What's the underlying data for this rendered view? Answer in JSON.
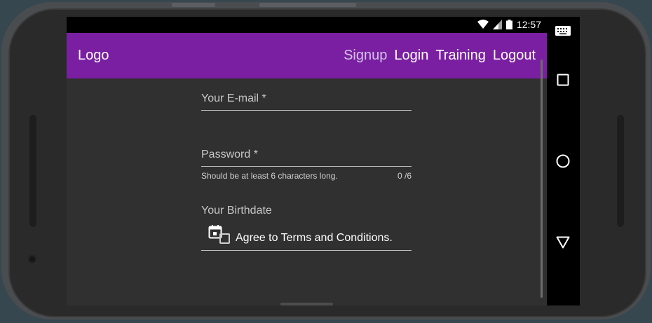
{
  "status_bar": {
    "time": "12:57",
    "icons": [
      "wifi-icon",
      "signal-icon",
      "battery-icon"
    ]
  },
  "app_bar": {
    "logo": "Logo",
    "nav": [
      "Signup",
      "Login",
      "Training",
      "Logout"
    ],
    "active_nav": "Signup",
    "color": "#7b1fa2"
  },
  "form": {
    "email": {
      "label": "Your E-mail *",
      "value": ""
    },
    "password": {
      "label": "Password *",
      "hint": "Should be at least 6 characters long.",
      "counter": "0 /6",
      "value": ""
    },
    "birthdate": {
      "label": "Your Birthdate",
      "icon": "calendar-icon",
      "value": ""
    },
    "terms": {
      "label": "Agree to Terms and Conditions.",
      "checked": false
    }
  },
  "system_nav": {
    "buttons": [
      "keyboard-icon",
      "recents-icon",
      "home-icon",
      "back-icon"
    ]
  }
}
